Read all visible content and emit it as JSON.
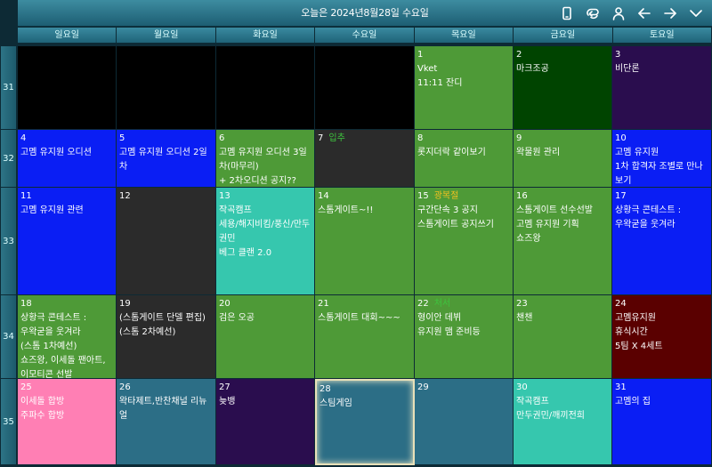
{
  "header": {
    "title": "오늘은 2024년8월28일 수요일",
    "icons": [
      "phone-icon",
      "sync-icon",
      "user-icon",
      "arrow-left-icon",
      "arrow-right-icon",
      "chevron-down-icon"
    ]
  },
  "weekdays": [
    "일요일",
    "월요일",
    "화요일",
    "수요일",
    "목요일",
    "금요일",
    "토요일"
  ],
  "week_numbers": [
    "31",
    "32",
    "33",
    "34",
    "35"
  ],
  "weeks": [
    [
      {
        "day": "",
        "color": "#000000",
        "events": []
      },
      {
        "day": "",
        "color": "#000000",
        "events": []
      },
      {
        "day": "",
        "color": "#000000",
        "events": []
      },
      {
        "day": "",
        "color": "#000000",
        "events": []
      },
      {
        "day": "1",
        "color": "#4e9a37",
        "events": [
          "Vket",
          "11:11 잔디"
        ]
      },
      {
        "day": "2",
        "color": "#004400",
        "events": [
          "마크조공"
        ]
      },
      {
        "day": "3",
        "color": "#2a0d4e",
        "events": [
          "비단론"
        ]
      }
    ],
    [
      {
        "day": "4",
        "color": "#0a1ef4",
        "events": [
          "고멤 유지원 오디션"
        ]
      },
      {
        "day": "5",
        "color": "#0a1ef4",
        "events": [
          "고멤 유지원 오디션 2일차"
        ]
      },
      {
        "day": "6",
        "color": "#4e9a37",
        "events": [
          "고멤 유지원 오디션 3일차(마무리)",
          "+ 2차오디션 공지??"
        ]
      },
      {
        "day": "7",
        "holiday": "입추",
        "holiday_color": "#3ec43e",
        "color": "#2b2b2b",
        "events": []
      },
      {
        "day": "8",
        "color": "#4e9a37",
        "events": [
          "롯지더락 같이보기"
        ]
      },
      {
        "day": "9",
        "color": "#4e9a37",
        "events": [
          "왁물원 관리"
        ]
      },
      {
        "day": "10",
        "color": "#0a1ef4",
        "events": [
          "고멤 유지원",
          "1차 합격자 조별로 만나보기"
        ]
      }
    ],
    [
      {
        "day": "11",
        "color": "#0a1ef4",
        "events": [
          "고멤 유지원 관련"
        ]
      },
      {
        "day": "12",
        "color": "#2b2b2b",
        "events": []
      },
      {
        "day": "13",
        "color": "#36c7ae",
        "events": [
          "작곡캠프",
          "세용/해지비킴/풍신/만두 권민",
          "베그 클랜 2.0"
        ]
      },
      {
        "day": "14",
        "color": "#4e9a37",
        "events": [
          "스톰게이트~!!"
        ]
      },
      {
        "day": "15",
        "holiday": "광복절",
        "holiday_color": "#f0c020",
        "color": "#4e9a37",
        "events": [
          "구간단속 3 공지",
          "스톰게이트 공지쓰기"
        ]
      },
      {
        "day": "16",
        "color": "#4e9a37",
        "events": [
          "스톰게이트 선수선발",
          "고멤 유지원 기획",
          "쇼즈왕"
        ]
      },
      {
        "day": "17",
        "color": "#0a1ef4",
        "events": [
          "상황극 콘테스트 :",
          "우왁굳을 웃겨라"
        ]
      }
    ],
    [
      {
        "day": "18",
        "color": "#4e9a37",
        "events": [
          "상황극 콘테스트 :",
          "우왁굳을 웃겨라",
          "(스톰 1차예선)",
          "쇼즈왕, 이세돌 팬아트,",
          "이모티콘 선발"
        ]
      },
      {
        "day": "19",
        "color": "#2b2b2b",
        "events": [
          "(스톰게이트 단델 편집)",
          "(스톰 2차예선)"
        ]
      },
      {
        "day": "20",
        "color": "#4e9a37",
        "events": [
          "검은 오공"
        ]
      },
      {
        "day": "21",
        "color": "#4e9a37",
        "events": [
          "스톰게이트 대회~~~"
        ]
      },
      {
        "day": "22",
        "holiday": "처서",
        "holiday_color": "#3ec43e",
        "color": "#4e9a37",
        "events": [
          "형이안 데뷔",
          "유지원 맴 준비등"
        ]
      },
      {
        "day": "23",
        "color": "#4e9a37",
        "events": [
          "챈챈"
        ]
      },
      {
        "day": "24",
        "color": "#5a0000",
        "events": [
          "고멤유지원",
          "휴식시간",
          "5팀 X 4세트"
        ]
      }
    ],
    [
      {
        "day": "25",
        "color": "#ff7fb4",
        "events": [
          "이세돌 합방",
          "주파수 합방"
        ]
      },
      {
        "day": "26",
        "color": "#2c6e86",
        "events": [
          "왁타제트,반찬채널 리뉴얼"
        ]
      },
      {
        "day": "27",
        "color": "#2a0d4e",
        "events": [
          "늦뱅"
        ]
      },
      {
        "day": "28",
        "color": "#2c6e86",
        "today": true,
        "events": [
          "스팀게임"
        ]
      },
      {
        "day": "29",
        "color": "#2c6e86",
        "events": []
      },
      {
        "day": "30",
        "color": "#36c7ae",
        "events": [
          "작곡캠프",
          "만두권민/깨끼전희"
        ]
      },
      {
        "day": "31",
        "color": "#0a1ef4",
        "events": [
          "고멤의 집"
        ]
      }
    ]
  ]
}
